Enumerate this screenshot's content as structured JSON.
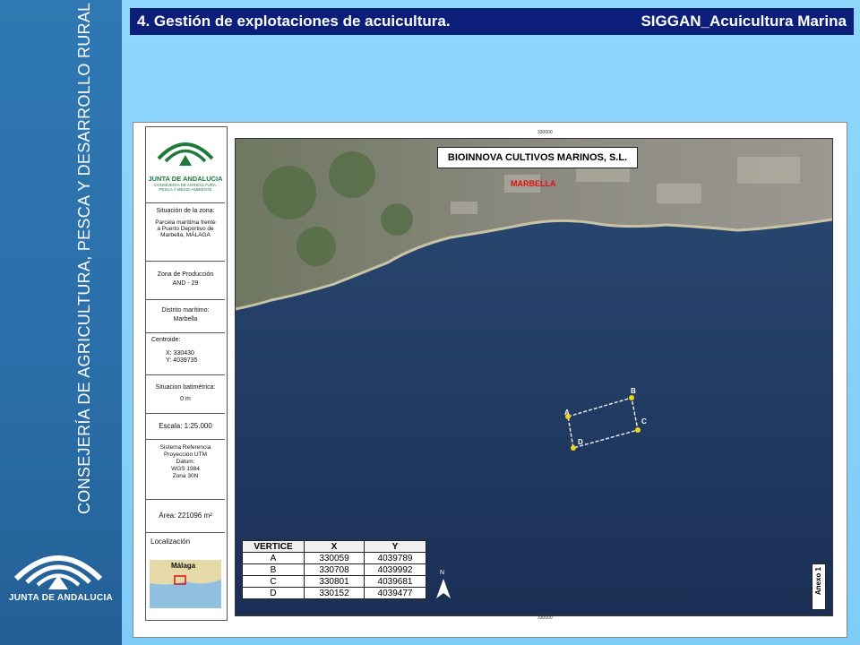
{
  "header": {
    "left_title": "4. Gestión de explotaciones de acuicultura.",
    "right_title": "SIGGAN_Acuicultura Marina"
  },
  "sidebar": {
    "vertical_text": "CONSEJERÍA DE AGRICULTURA, PESCA Y DESARROLLO RURAL",
    "logo_text": "JUNTA DE ANDALUCIA"
  },
  "legend": {
    "logo_title": "JUNTA DE ANDALUCIA",
    "logo_subtitle": "CONSEJERIA DE AGRICULTURA, PESCA Y MEDIO AMBIENTE",
    "situacion_label": "Situación de la zona:",
    "situacion_value": "Parcela marítima frente a Puerto Deportivo de Marbella, MÁLAGA",
    "zona_label": "Zona de Producción",
    "zona_value": "AND - 29",
    "distrito_label": "Distrito marítimo:",
    "distrito_value": "Marbella",
    "centroide_label": "Centroide:",
    "centroide_x": "X:  330430",
    "centroide_y": "Y:  4039735",
    "batimetrica_label": "Situacion batimétrica:",
    "batimetrica_value": "0 m",
    "escala": "Escala:   1:25.000",
    "sistema_label": "Sistema Referencia",
    "sistema_proy": "Proyección UTM",
    "sistema_datum": "Datum:",
    "sistema_wgs": "WGS 1984",
    "sistema_zona": "Zona 30N",
    "area": "Área:  221096 m²",
    "localizacion_label": "Localización",
    "localizacion_city": "Málaga"
  },
  "map": {
    "title": "BIOINNOVA CULTIVOS MARINOS, S.L.",
    "city": "MARBELLA",
    "annex": "Anexo 1",
    "north": "N",
    "tick_top": "330000",
    "tick_bottom": "330000",
    "vertices_labels": [
      "A",
      "B",
      "C",
      "D"
    ],
    "colors": {
      "sea": "#1f3a63",
      "polygon": "#e8e8e8",
      "vertex": "#f2d21b"
    }
  },
  "table": {
    "headers": [
      "VERTICE",
      "X",
      "Y"
    ],
    "rows": [
      [
        "A",
        "330059",
        "4039789"
      ],
      [
        "B",
        "330708",
        "4039992"
      ],
      [
        "C",
        "330801",
        "4039681"
      ],
      [
        "D",
        "330152",
        "4039477"
      ]
    ]
  }
}
